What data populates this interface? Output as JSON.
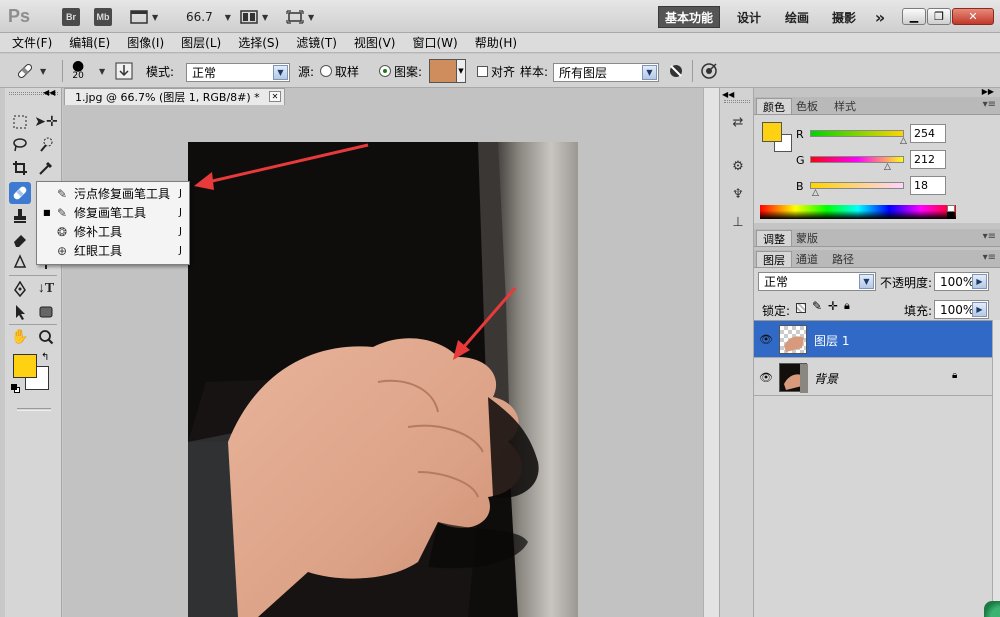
{
  "titlebar": {
    "logo": "Ps",
    "bridge": "Br",
    "minibridge": "Mb",
    "zoom": "66.7",
    "workspaces": [
      "基本功能",
      "设计",
      "绘画",
      "摄影"
    ],
    "more": "»"
  },
  "menu": [
    "文件(F)",
    "编辑(E)",
    "图像(I)",
    "图层(L)",
    "选择(S)",
    "滤镜(T)",
    "视图(V)",
    "窗口(W)",
    "帮助(H)"
  ],
  "options": {
    "brush_size": "20",
    "mode_label": "模式:",
    "mode_value": "正常",
    "source_label": "源:",
    "sampled_label": "取样",
    "pattern_label": "图案:",
    "pattern_color": "#cf8c5c",
    "aligned_label": "对齐",
    "sample_label": "样本:",
    "sample_value": "所有图层"
  },
  "document": {
    "tab_title": "1.jpg @ 66.7% (图层 1, RGB/8#) *"
  },
  "flyout": [
    {
      "label": "污点修复画笔工具",
      "key": "J",
      "icon": "spot-healing-icon",
      "selected": false
    },
    {
      "label": "修复画笔工具",
      "key": "J",
      "icon": "healing-brush-icon",
      "selected": true
    },
    {
      "label": "修补工具",
      "key": "J",
      "icon": "patch-icon",
      "selected": false
    },
    {
      "label": "红眼工具",
      "key": "J",
      "icon": "red-eye-icon",
      "selected": false
    }
  ],
  "colors": {
    "foreground": "#fed212",
    "background": "#ffffff",
    "selection": "#3169c6",
    "arrow": "#e83a3a"
  },
  "color_panel": {
    "tabs": [
      "颜色",
      "色板",
      "样式"
    ],
    "r_label": "R",
    "r_value": "254",
    "g_label": "G",
    "g_value": "212",
    "b_label": "B",
    "b_value": "18"
  },
  "adjust_panel": {
    "tabs": [
      "调整",
      "蒙版"
    ]
  },
  "layers_panel": {
    "tabs": [
      "图层",
      "通道",
      "路径"
    ],
    "blend_mode": "正常",
    "opacity_label": "不透明度:",
    "opacity_value": "100%",
    "lock_label": "锁定:",
    "fill_label": "填充:",
    "fill_value": "100%",
    "layers": [
      {
        "name": "图层 1",
        "selected": true,
        "locked": false
      },
      {
        "name": "背景",
        "selected": false,
        "locked": true
      }
    ]
  }
}
